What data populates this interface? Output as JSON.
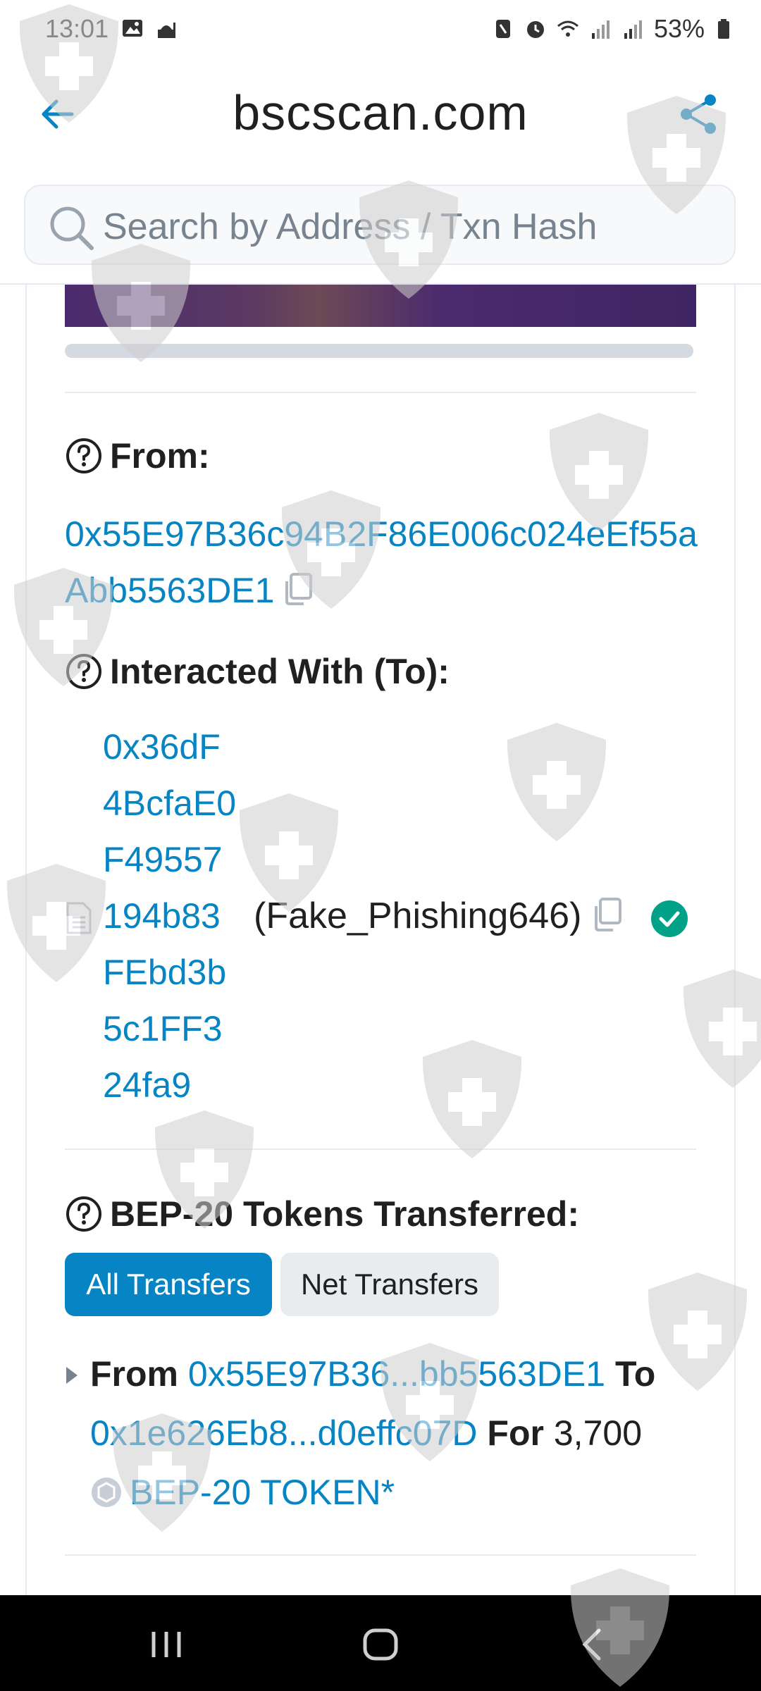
{
  "status_bar": {
    "time": "13:01",
    "battery": "53%"
  },
  "browser": {
    "domain": "bscscan.com",
    "search_placeholder": "Search by Address / Txn Hash / Block / Token"
  },
  "from": {
    "label": "From:",
    "address": "0x55E97B36c94B2F86E006c024eEf55aAbb5563DE1"
  },
  "to": {
    "label": "Interacted With (To):",
    "address_lines": [
      "0x36dF",
      "4BcfaE0",
      "F49557",
      "194b83",
      "FEbd3b",
      "5c1FF3",
      "24fa9"
    ],
    "name_tag": "(Fake_Phishing646)"
  },
  "tokens": {
    "label": "BEP-20 Tokens Transferred:",
    "tabs": [
      "All Transfers",
      "Net Transfers"
    ],
    "transfer": {
      "from_word": "From",
      "from_address": "0x55E97B36...bb5563DE1",
      "to_word": "To",
      "to_address": "0x1e626Eb8...d0effc07D",
      "for_word": "For",
      "amount": "3,700",
      "token": "BEP-20 TOKEN*"
    }
  },
  "colors": {
    "link": "#0784c3",
    "verified": "#00a186",
    "tab_active": "#0784c3"
  }
}
